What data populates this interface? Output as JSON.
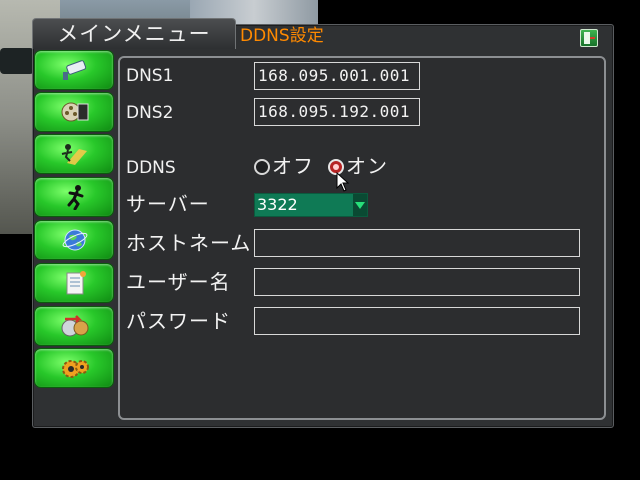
{
  "title": {
    "menu_label": "メインメニュー",
    "section_label": "DDNS設定"
  },
  "sidebar": {
    "items": [
      {
        "name": "camera",
        "icon": "camera-icon"
      },
      {
        "name": "record",
        "icon": "film-reel-icon"
      },
      {
        "name": "motion",
        "icon": "running-spotlight-icon"
      },
      {
        "name": "alarm",
        "icon": "running-man-icon"
      },
      {
        "name": "network",
        "icon": "globe-icon"
      },
      {
        "name": "log",
        "icon": "document-icon"
      },
      {
        "name": "backup",
        "icon": "disk-arrow-icon"
      },
      {
        "name": "system",
        "icon": "gears-icon"
      }
    ]
  },
  "form": {
    "dns1": {
      "label": "DNS1",
      "value": "168.095.001.001"
    },
    "dns2": {
      "label": "DNS2",
      "value": "168.095.192.001"
    },
    "ddns": {
      "label": "DDNS",
      "off_label": "オフ",
      "on_label": "オン",
      "selected": "on"
    },
    "server": {
      "label": "サーバー",
      "value": "3322"
    },
    "hostname": {
      "label": "ホストネーム",
      "value": ""
    },
    "username": {
      "label": "ユーザー名",
      "value": ""
    },
    "password": {
      "label": "パスワード",
      "value": ""
    }
  },
  "colors": {
    "accent": "#ff8a00",
    "sidebar_green": "#28c82a",
    "select_bg": "#0f7a55",
    "radio_on": "#b52323"
  }
}
